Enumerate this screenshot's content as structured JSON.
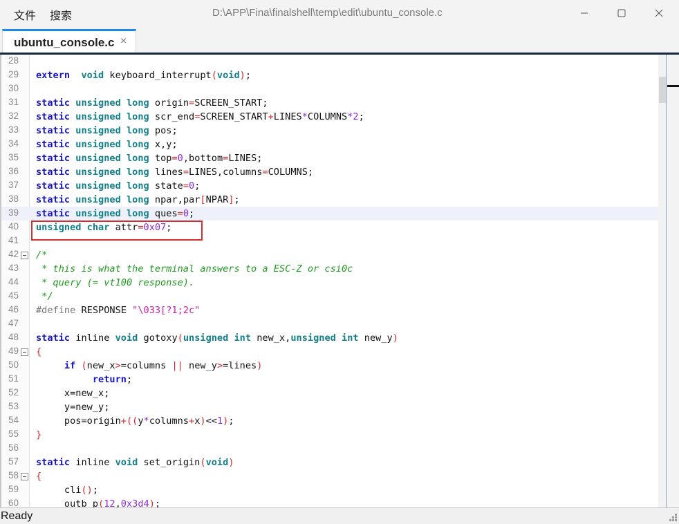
{
  "menu": {
    "file": "文件",
    "search": "搜索"
  },
  "window": {
    "title": "D:\\APP\\Fina\\finalshell\\temp\\edit\\ubuntu_console.c"
  },
  "tab": {
    "label": "ubuntu_console.c",
    "close": "×"
  },
  "status": {
    "text": "Ready"
  },
  "colors": {
    "tab_accent": "#1e88e5",
    "highlight_box": "#d32f2f"
  },
  "editor": {
    "current_line": 39,
    "highlighted_line": 40,
    "lines": [
      {
        "n": "28",
        "fold": false,
        "tokens": []
      },
      {
        "n": "29",
        "fold": false,
        "tokens": [
          [
            "kw",
            "extern"
          ],
          [
            "",
            "  "
          ],
          [
            "ty",
            "void"
          ],
          [
            "",
            " keyboard_interrupt"
          ],
          [
            "op",
            "("
          ],
          [
            "ty",
            "void"
          ],
          [
            "op",
            ")"
          ],
          [
            "",
            ";"
          ]
        ]
      },
      {
        "n": "30",
        "fold": false,
        "tokens": []
      },
      {
        "n": "31",
        "fold": false,
        "tokens": [
          [
            "kw",
            "static"
          ],
          [
            "",
            " "
          ],
          [
            "ty",
            "unsigned"
          ],
          [
            "",
            " "
          ],
          [
            "ty",
            "long"
          ],
          [
            "",
            " origin"
          ],
          [
            "op",
            "="
          ],
          [
            "",
            "SCREEN_START;"
          ]
        ]
      },
      {
        "n": "32",
        "fold": false,
        "tokens": [
          [
            "kw",
            "static"
          ],
          [
            "",
            " "
          ],
          [
            "ty",
            "unsigned"
          ],
          [
            "",
            " "
          ],
          [
            "ty",
            "long"
          ],
          [
            "",
            " scr_end"
          ],
          [
            "op",
            "="
          ],
          [
            "",
            "SCREEN_START"
          ],
          [
            "op",
            "+"
          ],
          [
            "",
            "LINES"
          ],
          [
            "num",
            "*"
          ],
          [
            "",
            "COLUMNS"
          ],
          [
            "num",
            "*"
          ],
          [
            "num",
            "2"
          ],
          [
            "",
            ";"
          ]
        ]
      },
      {
        "n": "33",
        "fold": false,
        "tokens": [
          [
            "kw",
            "static"
          ],
          [
            "",
            " "
          ],
          [
            "ty",
            "unsigned"
          ],
          [
            "",
            " "
          ],
          [
            "ty",
            "long"
          ],
          [
            "",
            " pos;"
          ]
        ]
      },
      {
        "n": "34",
        "fold": false,
        "tokens": [
          [
            "kw",
            "static"
          ],
          [
            "",
            " "
          ],
          [
            "ty",
            "unsigned"
          ],
          [
            "",
            " "
          ],
          [
            "ty",
            "long"
          ],
          [
            "",
            " x,y;"
          ]
        ]
      },
      {
        "n": "35",
        "fold": false,
        "tokens": [
          [
            "kw",
            "static"
          ],
          [
            "",
            " "
          ],
          [
            "ty",
            "unsigned"
          ],
          [
            "",
            " "
          ],
          [
            "ty",
            "long"
          ],
          [
            "",
            " top"
          ],
          [
            "op",
            "="
          ],
          [
            "num",
            "0"
          ],
          [
            "",
            ",bottom"
          ],
          [
            "op",
            "="
          ],
          [
            "",
            "LINES;"
          ]
        ]
      },
      {
        "n": "36",
        "fold": false,
        "tokens": [
          [
            "kw",
            "static"
          ],
          [
            "",
            " "
          ],
          [
            "ty",
            "unsigned"
          ],
          [
            "",
            " "
          ],
          [
            "ty",
            "long"
          ],
          [
            "",
            " lines"
          ],
          [
            "op",
            "="
          ],
          [
            "",
            "LINES,columns"
          ],
          [
            "op",
            "="
          ],
          [
            "",
            "COLUMNS;"
          ]
        ]
      },
      {
        "n": "37",
        "fold": false,
        "tokens": [
          [
            "kw",
            "static"
          ],
          [
            "",
            " "
          ],
          [
            "ty",
            "unsigned"
          ],
          [
            "",
            " "
          ],
          [
            "ty",
            "long"
          ],
          [
            "",
            " state"
          ],
          [
            "op",
            "="
          ],
          [
            "num",
            "0"
          ],
          [
            "",
            ";"
          ]
        ]
      },
      {
        "n": "38",
        "fold": false,
        "tokens": [
          [
            "kw",
            "static"
          ],
          [
            "",
            " "
          ],
          [
            "ty",
            "unsigned"
          ],
          [
            "",
            " "
          ],
          [
            "ty",
            "long"
          ],
          [
            "",
            " npar,par"
          ],
          [
            "op",
            "["
          ],
          [
            "",
            "NPAR"
          ],
          [
            "op",
            "]"
          ],
          [
            "",
            ";"
          ]
        ]
      },
      {
        "n": "39",
        "fold": false,
        "tokens": [
          [
            "kw",
            "static"
          ],
          [
            "",
            " "
          ],
          [
            "ty",
            "unsigned"
          ],
          [
            "",
            " "
          ],
          [
            "ty",
            "long"
          ],
          [
            "",
            " ques"
          ],
          [
            "op",
            "="
          ],
          [
            "num",
            "0"
          ],
          [
            "",
            ";"
          ]
        ]
      },
      {
        "n": "40",
        "fold": false,
        "tokens": [
          [
            "ty",
            "unsigned"
          ],
          [
            "",
            " "
          ],
          [
            "ty",
            "char"
          ],
          [
            "",
            " attr"
          ],
          [
            "op",
            "="
          ],
          [
            "num",
            "0x07"
          ],
          [
            "",
            ";"
          ]
        ]
      },
      {
        "n": "41",
        "fold": false,
        "tokens": []
      },
      {
        "n": "42",
        "fold": true,
        "tokens": [
          [
            "cm",
            "/*"
          ]
        ]
      },
      {
        "n": "43",
        "fold": false,
        "tokens": [
          [
            "cm",
            " * this is what the terminal answers to a ESC-Z or csi0c"
          ]
        ]
      },
      {
        "n": "44",
        "fold": false,
        "tokens": [
          [
            "cm",
            " * query (= vt100 response)."
          ]
        ]
      },
      {
        "n": "45",
        "fold": false,
        "tokens": [
          [
            "cm",
            " */"
          ]
        ]
      },
      {
        "n": "46",
        "fold": false,
        "tokens": [
          [
            "pp",
            "#define"
          ],
          [
            "",
            " RESPONSE "
          ],
          [
            "str",
            "\"\\033[?1;2c\""
          ]
        ]
      },
      {
        "n": "47",
        "fold": false,
        "tokens": []
      },
      {
        "n": "48",
        "fold": false,
        "tokens": [
          [
            "kw",
            "static"
          ],
          [
            "",
            " inline "
          ],
          [
            "ty",
            "void"
          ],
          [
            "",
            " gotoxy"
          ],
          [
            "op",
            "("
          ],
          [
            "ty",
            "unsigned"
          ],
          [
            "",
            " "
          ],
          [
            "ty",
            "int"
          ],
          [
            "",
            " new_x,"
          ],
          [
            "ty",
            "unsigned"
          ],
          [
            "",
            " "
          ],
          [
            "ty",
            "int"
          ],
          [
            "",
            " new_y"
          ],
          [
            "op",
            ")"
          ]
        ]
      },
      {
        "n": "49",
        "fold": true,
        "tokens": [
          [
            "op",
            "{"
          ]
        ]
      },
      {
        "n": "50",
        "fold": false,
        "tokens": [
          [
            "",
            "     "
          ],
          [
            "kw",
            "if"
          ],
          [
            "",
            " "
          ],
          [
            "op",
            "("
          ],
          [
            "",
            "new_x"
          ],
          [
            "op",
            ">"
          ],
          [
            "",
            "=columns "
          ],
          [
            "op",
            "||"
          ],
          [
            "",
            " new_y"
          ],
          [
            "op",
            ">"
          ],
          [
            "",
            "=lines"
          ],
          [
            "op",
            ")"
          ]
        ]
      },
      {
        "n": "51",
        "fold": false,
        "tokens": [
          [
            "",
            "          "
          ],
          [
            "kw",
            "return"
          ],
          [
            "",
            ";"
          ]
        ]
      },
      {
        "n": "52",
        "fold": false,
        "tokens": [
          [
            "",
            "     x=new_x;"
          ]
        ]
      },
      {
        "n": "53",
        "fold": false,
        "tokens": [
          [
            "",
            "     y=new_y;"
          ]
        ]
      },
      {
        "n": "54",
        "fold": false,
        "tokens": [
          [
            "",
            "     pos=origin"
          ],
          [
            "op",
            "+(("
          ],
          [
            "",
            "y"
          ],
          [
            "num",
            "*"
          ],
          [
            "",
            "columns"
          ],
          [
            "op",
            "+"
          ],
          [
            "",
            "x"
          ],
          [
            "op",
            ")"
          ],
          [
            "",
            "<<"
          ],
          [
            "num",
            "1"
          ],
          [
            "op",
            ")"
          ],
          [
            "",
            ";"
          ]
        ]
      },
      {
        "n": "55",
        "fold": false,
        "tokens": [
          [
            "op",
            "}"
          ]
        ]
      },
      {
        "n": "56",
        "fold": false,
        "tokens": []
      },
      {
        "n": "57",
        "fold": false,
        "tokens": [
          [
            "kw",
            "static"
          ],
          [
            "",
            " inline "
          ],
          [
            "ty",
            "void"
          ],
          [
            "",
            " set_origin"
          ],
          [
            "op",
            "("
          ],
          [
            "ty",
            "void"
          ],
          [
            "op",
            ")"
          ]
        ]
      },
      {
        "n": "58",
        "fold": true,
        "tokens": [
          [
            "op",
            "{"
          ]
        ]
      },
      {
        "n": "59",
        "fold": false,
        "tokens": [
          [
            "",
            "     cli"
          ],
          [
            "op",
            "()"
          ],
          [
            "",
            ";"
          ]
        ]
      },
      {
        "n": "60",
        "fold": false,
        "tokens": [
          [
            "",
            "     outb_p"
          ],
          [
            "op",
            "("
          ],
          [
            "num",
            "12"
          ],
          [
            "",
            ","
          ],
          [
            "num",
            "0x3d4"
          ],
          [
            "op",
            ")"
          ],
          [
            "",
            ";"
          ]
        ]
      }
    ]
  }
}
